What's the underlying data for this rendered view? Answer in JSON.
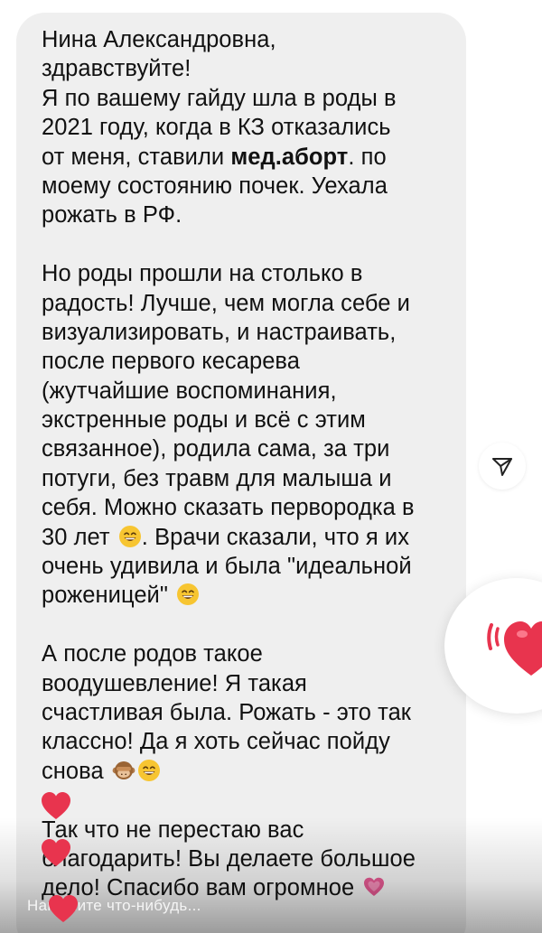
{
  "message": {
    "lines": [
      "Нина Александровна,",
      "здравствуйте!",
      "Я по вашему гайду шла в роды в",
      "2021 году, когда в КЗ отказались",
      "от меня, ставили",
      "мед.аборт",
      ". по",
      "моему состоянию почек. Уехала",
      "рожать в РФ.",
      "Но роды прошли на столько в",
      "радость! Лучше, чем могла себе и",
      "визуализировать, и настраивать,",
      "после первого кесарева",
      "(жутчайшие воспоминания,",
      "экстренные роды и всё с этим",
      "связанное), родила сама, за три",
      "потуги, без травм для малыша и",
      "себя. Можно сказать первородка в",
      "30 лет",
      ". Врачи сказали, что я их",
      "очень удивила и была \"идеальной",
      "роженицей\"",
      "А после родов такое",
      "воодушевление! Я такая",
      "счастливая была. Рожать - это так",
      "классно! Да я хоть сейчас пойду",
      "снова",
      "Так что не перестаю вас",
      "благодарить! Вы делаете большое",
      "дело! Спасибо вам огромное"
    ]
  },
  "reply": {
    "placeholder": "Напишите что-нибудь..."
  },
  "icons": {
    "share": "paper-plane-icon",
    "reaction": "heart-icon",
    "emoji_smile": "grinning-face-emoji",
    "emoji_monkey": "see-no-evil-monkey-emoji",
    "emoji_heart": "growing-heart-emoji"
  },
  "colors": {
    "bubble": "#efefef",
    "text": "#111111",
    "heart": "#e8344e"
  }
}
